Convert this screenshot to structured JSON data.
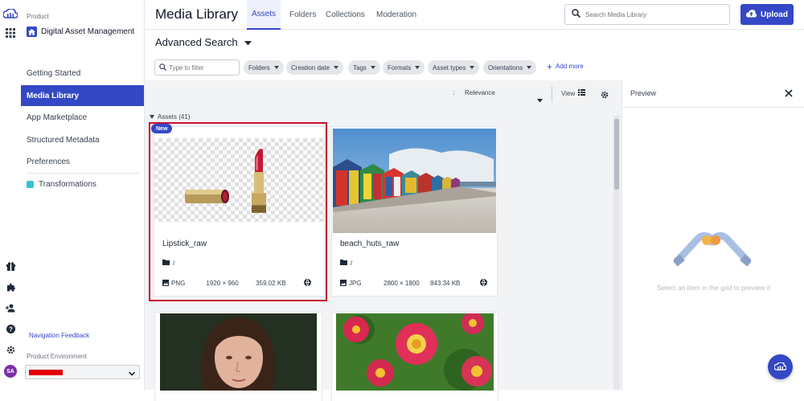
{
  "rail": {
    "icons": [
      "cloud-logo-icon",
      "apps-grid-icon",
      "gift-icon",
      "puzzle-icon",
      "add-user-icon",
      "help-icon",
      "settings-icon"
    ],
    "avatar": "SA"
  },
  "sidebar": {
    "product_label": "Product",
    "product_name": "Digital Asset Management",
    "items": [
      {
        "label": "Getting Started"
      },
      {
        "label": "Media Library",
        "active": true
      },
      {
        "label": "App Marketplace"
      },
      {
        "label": "Structured Metadata"
      },
      {
        "label": "Preferences"
      },
      {
        "label": "Transformations"
      }
    ],
    "feedback": "Navigation Feedback",
    "env_label": "Product Environment"
  },
  "header": {
    "title": "Media Library",
    "tabs": [
      {
        "label": "Assets",
        "active": true
      },
      {
        "label": "Folders"
      },
      {
        "label": "Collections"
      },
      {
        "label": "Moderation"
      }
    ],
    "search_placeholder": "Search Media Library",
    "upload_label": "Upload"
  },
  "search": {
    "advanced_label": "Advanced Search",
    "filter_placeholder": "Type to filter",
    "filters": [
      "Folders",
      "Creation date",
      "Tags",
      "Formats",
      "Asset types",
      "Orientations"
    ],
    "add_more": "Add more"
  },
  "toolbar": {
    "sort_label": "Relevance",
    "view_label": "View"
  },
  "assets": {
    "section_label": "Assets (41)",
    "cards": [
      {
        "name": "Lipstick_raw",
        "folder": "/",
        "format": "PNG",
        "dimensions": "1920 × 960",
        "size": "359.02 KB",
        "badge": "New",
        "selected": true
      },
      {
        "name": "beach_huts_raw",
        "folder": "/",
        "format": "JPG",
        "dimensions": "2800 × 1800",
        "size": "843.34 KB"
      }
    ]
  },
  "preview": {
    "title": "Preview",
    "hint": "Select an item in the grid to preview it"
  },
  "colors": {
    "accent": "#3448c5",
    "selection": "#c8102e",
    "env_redacted": "#e20000"
  }
}
